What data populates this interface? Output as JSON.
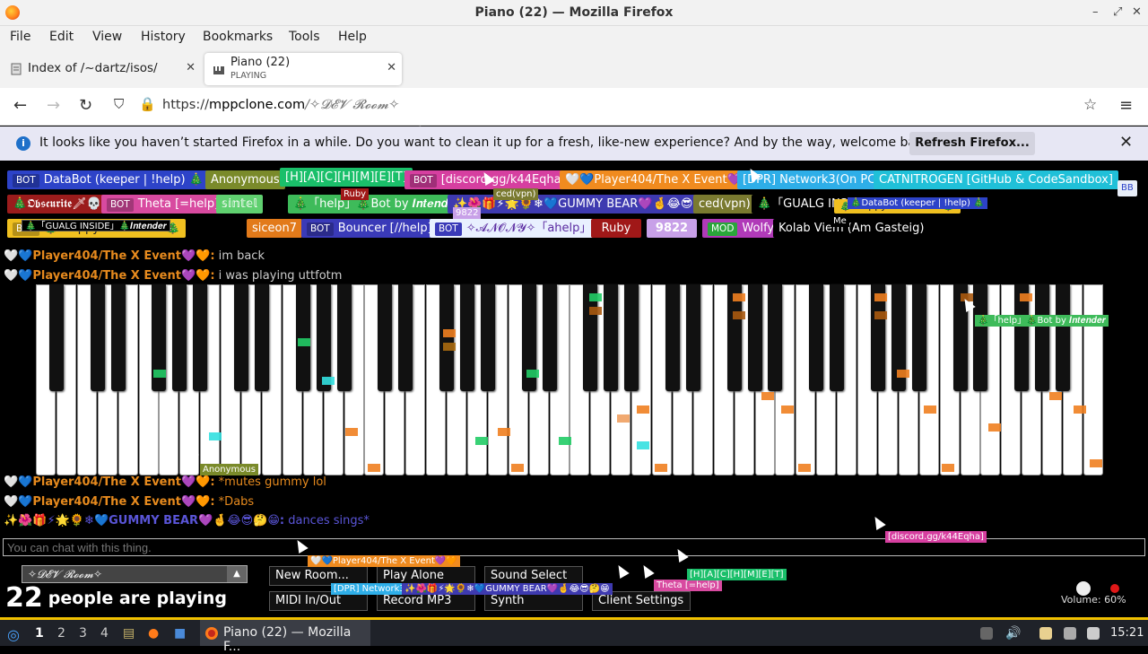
{
  "window": {
    "title": "Piano (22) — Mozilla Firefox"
  },
  "menu": [
    "File",
    "Edit",
    "View",
    "History",
    "Bookmarks",
    "Tools",
    "Help"
  ],
  "tabs": [
    {
      "label": "Index of /~dartz/isos/",
      "icon": "page-icon",
      "active": false
    },
    {
      "label": "Piano (22)",
      "sub": "PLAYING",
      "icon": "speaker-icon",
      "active": true
    }
  ],
  "nav": {
    "url_prefix": "https://",
    "url_domain": "mppclone.com",
    "url_path": "/✧𝓓𝓔𝓥 𝓡𝓸𝓸𝓶✧"
  },
  "infobar": {
    "text": "It looks like you haven’t started Firefox in a while. Do you want to clean it up for a fresh, like-new experience? And by the way, welcome back!",
    "button": "Refresh Firefox..."
  },
  "users": [
    {
      "name": "DataBot (keeper | !help) 🎄",
      "bot": true,
      "color": "#2d43c8"
    },
    {
      "name": "Anonymous",
      "bot": false,
      "color": "#7a8a2a"
    },
    {
      "name": "[H][A][C][H][M][E][T]",
      "bot": false,
      "color": "#1abf6a"
    },
    {
      "name": "[discord.gg/k44Eqha]",
      "bot": true,
      "color": "#d63fa0"
    },
    {
      "name": "🤍💙Player404/The X Event💜🧡",
      "bot": false,
      "color": "#f08b1f"
    },
    {
      "name": "[DPR] Network3(On PC)",
      "bot": false,
      "color": "#2eaee8"
    },
    {
      "name": "CATNITROGEN [GitHub & CodeSandbox]",
      "bot": false,
      "color": "#20c0d8"
    },
    {
      "name": "🎄𝕺𝖇𝖘𝖈𝖚𝖗𝖎𝖙𝖊🗡💀",
      "bot": false,
      "color": "#9b1c1c"
    },
    {
      "name": "Theta [=help]",
      "bot": true,
      "color": "#d84aa0"
    },
    {
      "name": "𝕤𝕚𝕟𝕥𝕖𝕝",
      "bot": false,
      "color": "#60d070"
    },
    {
      "name": "🎄「help」🎄Bot by 𝑰𝒏𝒕𝒆𝒏𝒅𝒆𝒓",
      "bot": false,
      "color": "#3ebb5a"
    },
    {
      "name": "✨🌺🎁⚡🌟🌻❄💙GUMMY BEAR💜🤞😂😎🤔😁",
      "bot": false,
      "color": "#3e3ab0"
    },
    {
      "name": "ced(vpn)",
      "bot": false,
      "color": "#7a7a30"
    },
    {
      "name": "🎄「GUALG INSIDE」",
      "bot": false,
      "color": "#000000"
    },
    {
      "name": "🎄 Happy New Year! 🎄",
      "bot": true,
      "color": "#f0c020"
    },
    {
      "name": "siceon7",
      "bot": false,
      "color": "#e27a1a"
    },
    {
      "name": "Bouncer [//help]",
      "bot": true,
      "color": "#3a3ab8"
    },
    {
      "name": "✧𝓐𝓝𝓞𝓝𝓨✧「ahelp」",
      "bot": true,
      "color": "#e9f0ff"
    },
    {
      "name": "Ruby",
      "bot": false,
      "color": "#a01818"
    },
    {
      "name": "9822",
      "bot": false,
      "color": "#c8a0e8"
    },
    {
      "name": "Wolfy",
      "bot": false,
      "mod": true,
      "color": "#b03ab8"
    },
    {
      "name": "Kolab Viem (Am Gasteig)",
      "bot": false,
      "color": "#000000"
    }
  ],
  "labels": {
    "bot": "BOT",
    "mod": "MOD"
  },
  "chat": [
    {
      "name": "🤍💙Player404/The X Event💜🧡:",
      "msg": " im back",
      "color": "#e68a1e"
    },
    {
      "name": "🤍💙Player404/The X Event💜🧡:",
      "msg": " i was playing uttfotm",
      "color": "#e68a1e"
    },
    {
      "name": "🤍💙Player404/The X Event💜🧡:",
      "msg": " *mutes gummy lol",
      "color": "#e68a1e"
    },
    {
      "name": "🤍💙Player404/The X Event💜🧡:",
      "msg": " *Dabs",
      "color": "#e68a1e"
    },
    {
      "name": "✨🌺🎁⚡🌟🌻❄💙GUMMY BEAR💜🤞😂😎🤔😁:",
      "msg": " dances sings*",
      "color": "#5a55d8"
    }
  ],
  "chat_input": {
    "placeholder": "You can chat with this thing."
  },
  "room": {
    "name": "✧𝓓𝓔𝓥 𝓡𝓸𝓸𝓶✧",
    "count": "22",
    "playing_text": "people are playing"
  },
  "controls": [
    "New Room...",
    "Play Alone",
    "Sound Select",
    "MIDI In/Out",
    "Record MP3",
    "Synth",
    "Client Settings"
  ],
  "volume": "Volume: 60%",
  "floating_tags": [
    {
      "name": "Ruby",
      "color": "#a01818"
    },
    {
      "name": "ced(vpn)",
      "color": "#7a7a30"
    },
    {
      "name": "9822",
      "color": "#c8a0e8"
    },
    {
      "name": "Anonymous",
      "color": "#7a8a2a"
    },
    {
      "name": "🎄「GUALG INSIDE」🎄𝑰𝒏𝒕𝒆𝒏𝒅𝒆𝒓",
      "color": "#000000"
    },
    {
      "name": "🎄DataBot (keeper | !help) 🎄",
      "color": "#2d43c8"
    },
    {
      "name": "Me",
      "color": "#000000"
    },
    {
      "name": "🎄「help」🎄Bot by 𝑰𝒏𝒕𝒆𝒏𝒅𝒆𝒓",
      "color": "#3ebb5a"
    },
    {
      "name": "[discord.gg/k44Eqha]",
      "color": "#d63fa0"
    },
    {
      "name": "🤍💙Player404/The X Event💜🧡",
      "color": "#f08b1f"
    },
    {
      "name": "[DPR] Network3",
      "color": "#2eaee8"
    },
    {
      "name": "✨🌺🎁⚡🌟🌻❄💙GUMMY BEAR💜🤞😂😎🤔😁",
      "color": "#3e3ab0"
    },
    {
      "name": "Theta [=help]",
      "color": "#d84aa0"
    },
    {
      "name": "[H][A][C][H][M][E][T]",
      "color": "#1abf6a"
    },
    {
      "name": "[discord.gg/k44Eqha]",
      "color": "#d63fa0"
    }
  ],
  "taskbar": {
    "workspaces": [
      "1",
      "2",
      "3",
      "4"
    ],
    "window": "Piano (22) — Mozilla F...",
    "clock": "15:21"
  },
  "colors": {
    "accent": "#0060df",
    "taskbar_border": "#f0c000"
  }
}
